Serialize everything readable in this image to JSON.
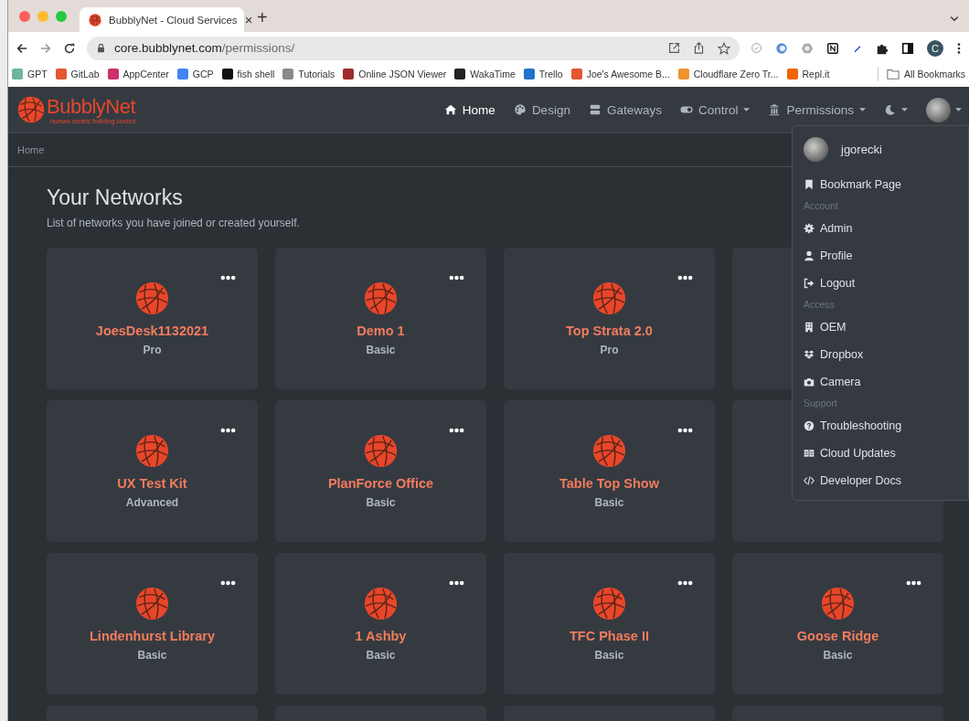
{
  "browser": {
    "tab": {
      "title": "BubblyNet - Cloud Services",
      "close": "×"
    },
    "new_tab": "+",
    "url": {
      "host": "core.bubblynet.com",
      "path": "/permissions/"
    },
    "profile": "C",
    "bookmarks": [
      {
        "label": "GPT",
        "color": "#6fb59a"
      },
      {
        "label": "GitLab",
        "color": "#e2572f"
      },
      {
        "label": "AppCenter",
        "color": "#cc2f6b"
      },
      {
        "label": "GCP",
        "color": "#4285f4"
      },
      {
        "label": "fish shell",
        "color": "#111111"
      },
      {
        "label": "Tutorials",
        "color": "#8a8a8a"
      },
      {
        "label": "Online JSON Viewer",
        "color": "#9e2a2a"
      },
      {
        "label": "WakaTime",
        "color": "#222222"
      },
      {
        "label": "Trello",
        "color": "#1f74c9"
      },
      {
        "label": "Joe's Awesome B...",
        "color": "#e2572f"
      },
      {
        "label": "Cloudflare Zero Tr...",
        "color": "#f0932f"
      },
      {
        "label": "Repl.it",
        "color": "#f26207"
      }
    ],
    "all_bookmarks": "All Bookmarks"
  },
  "navbar": {
    "brand": "BubblyNet",
    "tagline": "human-centric building control",
    "items": [
      {
        "label": "Home",
        "selected": true,
        "dropdown": false
      },
      {
        "label": "Design",
        "selected": false,
        "dropdown": false
      },
      {
        "label": "Gateways",
        "selected": false,
        "dropdown": false
      },
      {
        "label": "Control",
        "selected": false,
        "dropdown": true
      },
      {
        "label": "Permissions",
        "selected": false,
        "dropdown": true
      }
    ]
  },
  "breadcrumb": "Home",
  "page": {
    "title": "Your Networks",
    "subtitle": "List of networks you have joined or created yourself."
  },
  "networks": [
    {
      "kind": "network",
      "name": "JoesDesk1132021",
      "plan": "Pro"
    },
    {
      "kind": "network",
      "name": "Demo 1",
      "plan": "Basic"
    },
    {
      "kind": "network",
      "name": "Top Strata 2.0",
      "plan": "Pro"
    },
    {
      "kind": "blank"
    },
    {
      "kind": "network",
      "name": "UX Test Kit",
      "plan": "Advanced"
    },
    {
      "kind": "network",
      "name": "PlanForce Office",
      "plan": "Basic"
    },
    {
      "kind": "network",
      "name": "Table Top Show",
      "plan": "Basic"
    },
    {
      "kind": "blank"
    },
    {
      "kind": "network",
      "name": "Lindenhurst Library",
      "plan": "Basic"
    },
    {
      "kind": "network",
      "name": "1 Ashby",
      "plan": "Basic"
    },
    {
      "kind": "network",
      "name": "TFC Phase II",
      "plan": "Basic"
    },
    {
      "kind": "network",
      "name": "Goose Ridge",
      "plan": "Basic"
    },
    {
      "kind": "blank"
    },
    {
      "kind": "blank"
    },
    {
      "kind": "blank"
    },
    {
      "kind": "blank"
    }
  ],
  "user_menu": {
    "username": "jgorecki",
    "items": [
      {
        "kind": "item",
        "label": "Bookmark Page"
      },
      {
        "kind": "header",
        "label": "Account"
      },
      {
        "kind": "item",
        "label": "Admin"
      },
      {
        "kind": "item",
        "label": "Profile"
      },
      {
        "kind": "item",
        "label": "Logout"
      },
      {
        "kind": "header",
        "label": "Access"
      },
      {
        "kind": "item",
        "label": "OEM"
      },
      {
        "kind": "item",
        "label": "Dropbox"
      },
      {
        "kind": "item",
        "label": "Camera"
      },
      {
        "kind": "header",
        "label": "Support"
      },
      {
        "kind": "item",
        "label": "Troubleshooting"
      },
      {
        "kind": "item",
        "label": "Cloud Updates"
      },
      {
        "kind": "item",
        "label": "Developer Docs"
      }
    ]
  }
}
